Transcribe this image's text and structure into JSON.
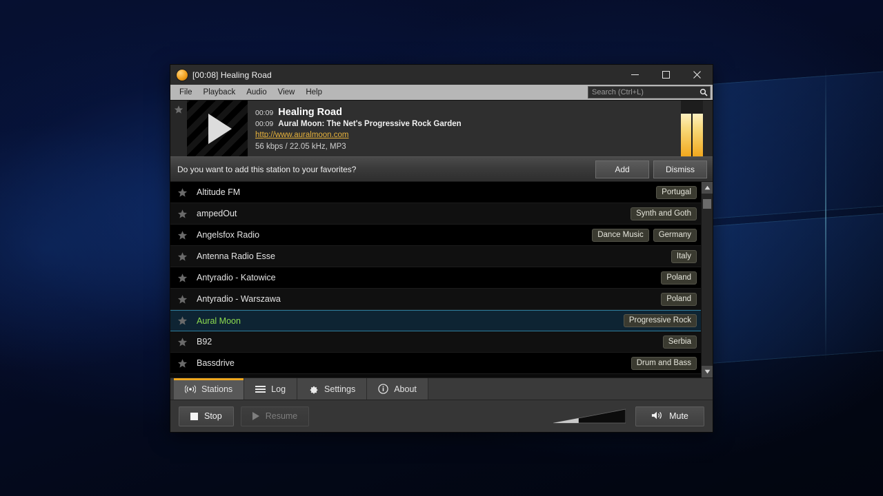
{
  "window": {
    "title": "[00:08] Healing Road",
    "app_icon": "orange-circle-icon",
    "minimize_label": "Minimize",
    "maximize_label": "Maximize",
    "close_label": "Close"
  },
  "menubar": {
    "items": [
      {
        "label": "File"
      },
      {
        "label": "Playback"
      },
      {
        "label": "Audio"
      },
      {
        "label": "View"
      },
      {
        "label": "Help"
      }
    ]
  },
  "search": {
    "placeholder": "Search (Ctrl+L)",
    "value": "",
    "icon": "search-icon"
  },
  "now_playing": {
    "favorite_icon": "star-icon",
    "thumbnail_icon": "play-icon",
    "title_time": "00:09",
    "title": "Healing Road",
    "desc_time": "00:09",
    "description": "Aural Moon: The Net's Progressive Rock Garden",
    "url": "http://www.auralmoon.com",
    "format": "56 kbps / 22.05 kHz, MP3",
    "meter_color": "#f2a81d"
  },
  "notification": {
    "text": "Do you want to add this station to your favorites?",
    "add_label": "Add",
    "dismiss_label": "Dismiss"
  },
  "stations": {
    "rows": [
      {
        "name": "Altitude FM",
        "tags": [
          "Portugal"
        ],
        "selected": false
      },
      {
        "name": "ampedOut",
        "tags": [
          "Synth and Goth"
        ],
        "selected": false
      },
      {
        "name": "Angelsfox Radio",
        "tags": [
          "Dance Music",
          "Germany"
        ],
        "selected": false
      },
      {
        "name": "Antenna Radio Esse",
        "tags": [
          "Italy"
        ],
        "selected": false
      },
      {
        "name": "Antyradio - Katowice",
        "tags": [
          "Poland"
        ],
        "selected": false
      },
      {
        "name": "Antyradio - Warszawa",
        "tags": [
          "Poland"
        ],
        "selected": false
      },
      {
        "name": "Aural Moon",
        "tags": [
          "Progressive Rock"
        ],
        "selected": true
      },
      {
        "name": "B92",
        "tags": [
          "Serbia"
        ],
        "selected": false
      },
      {
        "name": "Bassdrive",
        "tags": [
          "Drum and Bass"
        ],
        "selected": false
      }
    ],
    "selected_text_color": "#8ddb4f",
    "scrollbar": {
      "up_icon": "chevron-up-icon",
      "down_icon": "chevron-down-icon"
    }
  },
  "tabs": [
    {
      "label": "Stations",
      "icon": "broadcast-icon",
      "active": true
    },
    {
      "label": "Log",
      "icon": "list-icon",
      "active": false
    },
    {
      "label": "Settings",
      "icon": "gear-icon",
      "active": false
    },
    {
      "label": "About",
      "icon": "info-icon",
      "active": false
    }
  ],
  "transport": {
    "stop_label": "Stop",
    "stop_icon": "stop-icon",
    "resume_label": "Resume",
    "resume_icon": "play-icon",
    "resume_disabled": true,
    "volume_level": 35,
    "mute_label": "Mute",
    "mute_icon": "speaker-icon"
  },
  "theme": {
    "accent": "#f0a81e",
    "selection_border": "#2f7f9e",
    "link": "#e8b33c"
  }
}
